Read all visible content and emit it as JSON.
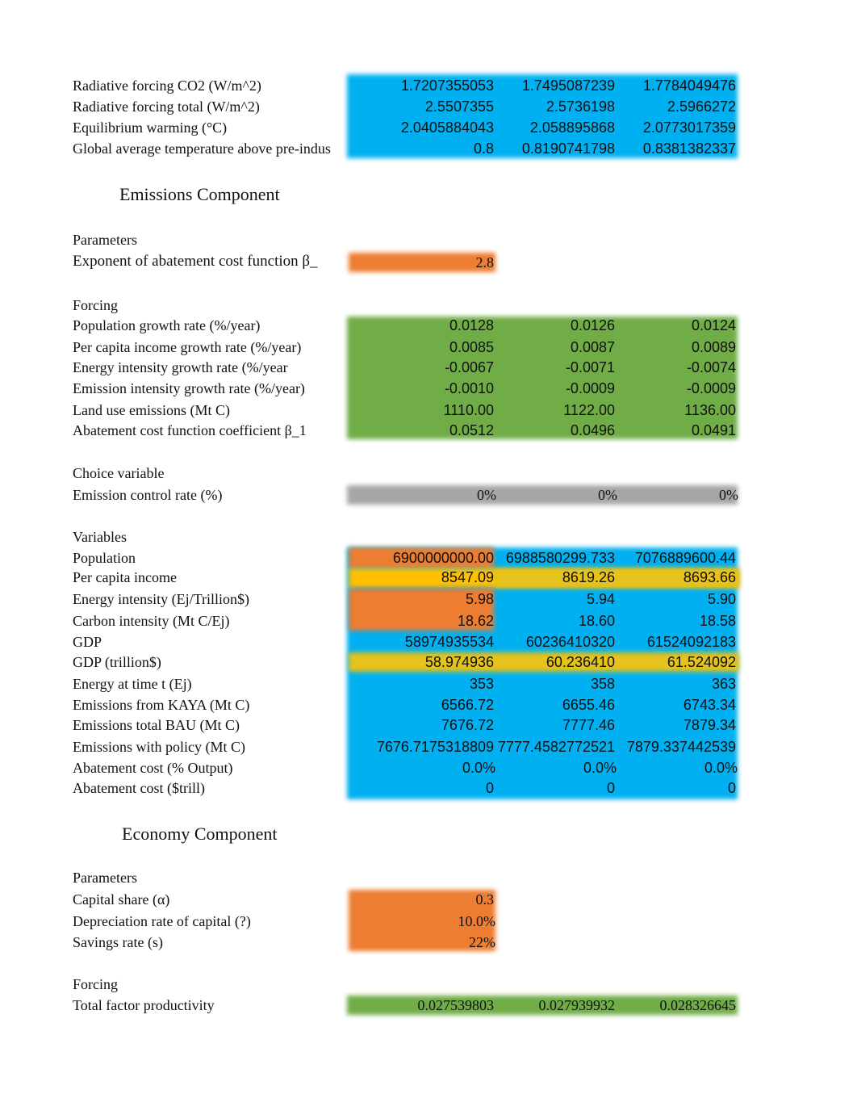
{
  "colors": {
    "blue": "#00b0f0",
    "orange": "#ed7d31",
    "green": "#70ad47",
    "yellow": "#ffc000",
    "gold": "#e6c21a",
    "gray": "#a6a6a6"
  },
  "climate": {
    "rows": [
      {
        "label": "Radiative forcing CO2 (W/m^2)",
        "values": [
          "1.7207355053",
          "1.7495087239",
          "1.7784049476"
        ]
      },
      {
        "label": "Radiative forcing total (W/m^2)",
        "values": [
          "2.5507355",
          "2.5736198",
          "2.5966272"
        ]
      },
      {
        "label": "Equilibrium warming (°C)",
        "values": [
          "2.0405884043",
          "2.058895868",
          "2.0773017359"
        ]
      },
      {
        "label": "Global average temperature above pre-indus",
        "values": [
          "0.8",
          "0.8190741798",
          "0.8381382337"
        ]
      }
    ]
  },
  "emissions": {
    "title": "Emissions Component",
    "parameters_label": "Parameters",
    "parameters": [
      {
        "label": "Exponent of abatement cost function β_",
        "value": "2.8"
      }
    ],
    "forcing_label": "Forcing",
    "forcing": [
      {
        "label": "Population growth rate (%/year)",
        "values": [
          "0.0128",
          "0.0126",
          "0.0124"
        ]
      },
      {
        "label": "Per capita income growth rate (%/year)",
        "values": [
          "0.0085",
          "0.0087",
          "0.0089"
        ]
      },
      {
        "label": "Energy intensity growth rate (%/year",
        "values": [
          "-0.0067",
          "-0.0071",
          "-0.0074"
        ]
      },
      {
        "label": "Emission intensity growth rate (%/year)",
        "values": [
          "-0.0010",
          "-0.0009",
          "-0.0009"
        ]
      },
      {
        "label": "Land use emissions (Mt C)",
        "values": [
          "1110.00",
          "1122.00",
          "1136.00"
        ]
      },
      {
        "label": "Abatement cost function coefficient β_1",
        "values": [
          "0.0512",
          "0.0496",
          "0.0491"
        ]
      }
    ],
    "choice_label": "Choice variable",
    "choice": [
      {
        "label": "Emission control rate (%)",
        "values": [
          "0%",
          "0%",
          "0%"
        ]
      }
    ],
    "variables_label": "Variables",
    "variables": [
      {
        "label": "Population",
        "values": [
          "6900000000.00",
          "6988580299.733",
          "7076889600.44"
        ]
      },
      {
        "label": "Per capita income",
        "values": [
          "8547.09",
          "8619.26",
          "8693.66"
        ]
      },
      {
        "label": "Energy intensity (Ej/Trillion$)",
        "values": [
          "5.98",
          "5.94",
          "5.90"
        ]
      },
      {
        "label": "Carbon intensity (Mt C/Ej)",
        "values": [
          "18.62",
          "18.60",
          "18.58"
        ]
      },
      {
        "label": "GDP",
        "values": [
          "58974935534",
          "60236410320",
          "61524092183"
        ]
      },
      {
        "label": "GDP (trillion$)",
        "values": [
          "58.974936",
          "60.236410",
          "61.524092"
        ]
      },
      {
        "label": "Energy at time t (Ej)",
        "values": [
          "353",
          "358",
          "363"
        ]
      },
      {
        "label": "Emissions from KAYA (Mt C)",
        "values": [
          "6566.72",
          "6655.46",
          "6743.34"
        ]
      },
      {
        "label": "Emissions total BAU (Mt C)",
        "values": [
          "7676.72",
          "7777.46",
          "7879.34"
        ]
      },
      {
        "label": "Emissions with policy (Mt C)",
        "values": [
          "7676.7175318809",
          "7777.4582772521",
          "7879.337442539"
        ]
      },
      {
        "label": "Abatement cost (% Output)",
        "values": [
          "0.0%",
          "0.0%",
          "0.0%"
        ]
      },
      {
        "label": "Abatement cost ($trill)",
        "values": [
          "0",
          "0",
          "0"
        ]
      }
    ]
  },
  "economy": {
    "title": "Economy Component",
    "parameters_label": "Parameters",
    "parameters": [
      {
        "label": "Capital share (α)",
        "value": "0.3"
      },
      {
        "label": "Depreciation rate of capital (?)",
        "value": "10.0%"
      },
      {
        "label": "Savings rate (s)",
        "value": "22%"
      }
    ],
    "forcing_label": "Forcing",
    "forcing": [
      {
        "label": "Total factor productivity",
        "values": [
          "0.027539803",
          "0.027939932",
          "0.028326645"
        ]
      }
    ]
  }
}
